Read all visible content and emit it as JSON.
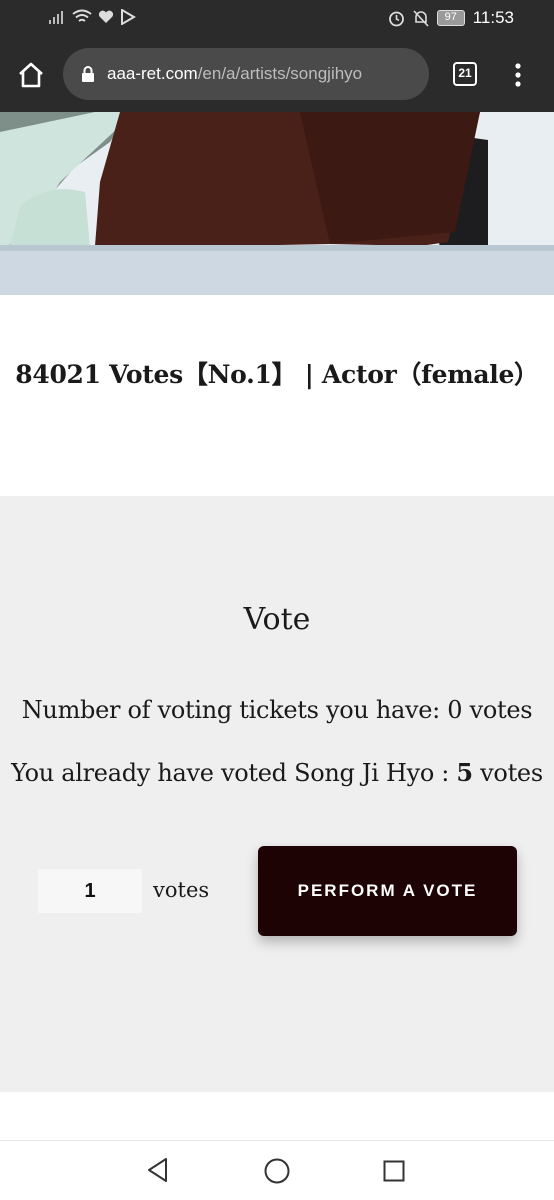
{
  "status_bar": {
    "time": "11:53",
    "battery": "97",
    "icons": [
      "signal-icon",
      "wifi-icon",
      "heart-icon",
      "play-store-icon",
      "alarm-icon",
      "mute-icon",
      "battery-icon"
    ]
  },
  "browser": {
    "url_host": "aaa-ret.com",
    "url_path": "/en/a/artists/songjihyo",
    "tab_count": "21",
    "icons": [
      "home-icon",
      "lock-icon",
      "tabs-icon",
      "more-menu-icon"
    ]
  },
  "headline": {
    "text": "84021 Votes【No.1】 | Actor（female）"
  },
  "vote": {
    "title": "Vote",
    "tickets_line": "Number of voting tickets you have: 0 votes",
    "voted_prefix": "You already have voted Song Ji Hyo : ",
    "voted_count": "5",
    "voted_suffix": " votes",
    "quantity_value": "1",
    "quantity_unit": "votes",
    "button_label": "PERFORM A VOTE"
  },
  "colors": {
    "button_bg": "#1e0304",
    "panel_bg": "#efefef",
    "toolbar_bg": "#2b2b2b"
  },
  "nav_bar": {
    "icons": [
      "back-icon",
      "home-circle-icon",
      "recent-apps-icon"
    ]
  }
}
